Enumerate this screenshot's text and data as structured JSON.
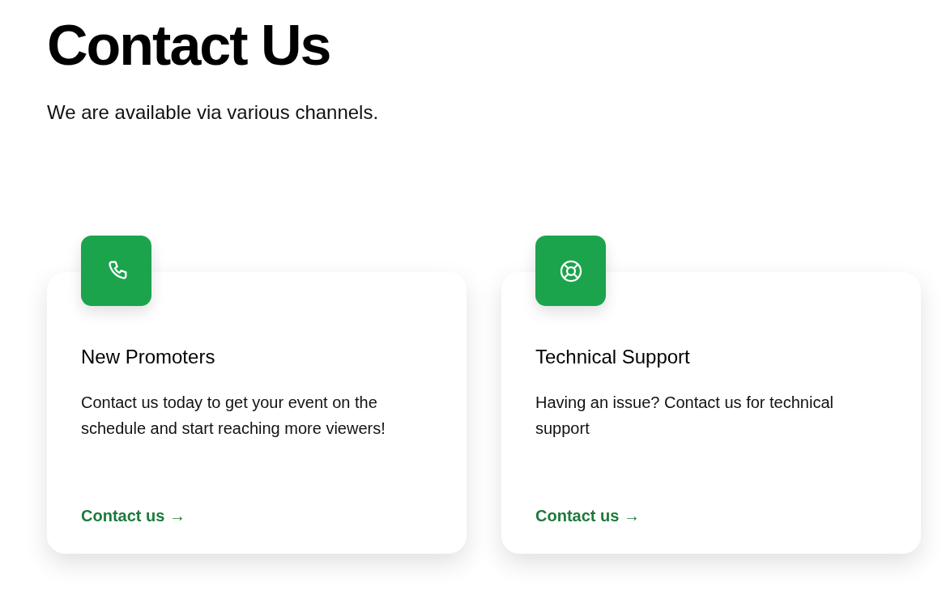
{
  "header": {
    "title": "Contact Us",
    "subtitle": "We are available via various channels."
  },
  "cards": [
    {
      "kind": "phone",
      "title": "New Promoters",
      "description": "Contact us today to get your event on the schedule and start reaching more viewers!",
      "link": "Contact us →"
    },
    {
      "kind": "lifebuoy",
      "title": "Technical Support",
      "description": "Having an issue? Contact us for technical support",
      "link": "Contact us →"
    }
  ]
}
